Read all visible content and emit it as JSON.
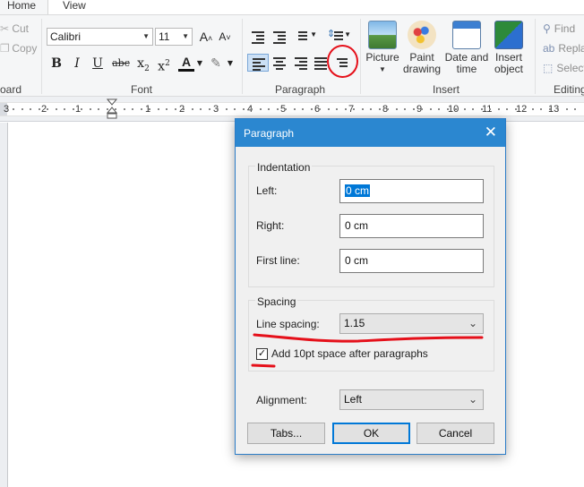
{
  "tabs": [
    {
      "label": "Home",
      "active": true
    },
    {
      "label": "View",
      "active": false
    }
  ],
  "ribbon": {
    "clipboard": {
      "cut_label": "Cut",
      "copy_label": "Copy",
      "group_label_partial": "oard"
    },
    "font": {
      "font_name": "Calibri",
      "font_size": "11",
      "grow_label": "A",
      "shrink_label": "A",
      "bold_label": "B",
      "italic_label": "I",
      "underline_label": "U",
      "strike_label": "abc",
      "subscript_label": "x",
      "subscript_mark": "2",
      "superscript_label": "x",
      "superscript_mark": "2",
      "color_label": "A",
      "group_label": "Font"
    },
    "paragraph": {
      "group_label": "Paragraph"
    },
    "insert": {
      "picture_label": "Picture",
      "paint_label_1": "Paint",
      "paint_label_2": "drawing",
      "datetime_label_1": "Date and",
      "datetime_label_2": "time",
      "object_label_1": "Insert",
      "object_label_2": "object",
      "group_label": "Insert"
    },
    "editing": {
      "find_label": "Find",
      "replace_label": "Repla",
      "select_label": "Select",
      "group_label": "Editing"
    }
  },
  "ruler": {
    "numbers": [
      "3",
      "2",
      "1",
      "1",
      "2",
      "3",
      "4",
      "5",
      "6",
      "7",
      "8",
      "9",
      "10",
      "11",
      "12",
      "13"
    ]
  },
  "dialog": {
    "title": "Paragraph",
    "close_glyph": "✕",
    "indentation": {
      "group_label": "Indentation",
      "left_label": "Left:",
      "left_value": "0 cm",
      "right_label": "Right:",
      "right_value": "0 cm",
      "first_line_label": "First line:",
      "first_line_value": "0 cm"
    },
    "spacing": {
      "group_label": "Spacing",
      "line_spacing_label": "Line spacing:",
      "line_spacing_value": "1.15",
      "add_space_label": "Add 10pt space after paragraphs",
      "add_space_checked": true,
      "check_glyph": "✓"
    },
    "alignment": {
      "label": "Alignment:",
      "value": "Left"
    },
    "buttons": {
      "tabs": "Tabs...",
      "ok": "OK",
      "cancel": "Cancel"
    }
  },
  "colors": {
    "titlebar": "#2b87d0",
    "annotation_red": "#e5101a",
    "selection": "#0078d7"
  }
}
